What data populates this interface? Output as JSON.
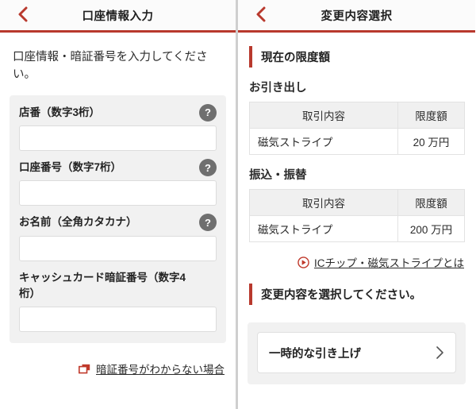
{
  "left_panel": {
    "header": {
      "title": "口座情報入力",
      "back_icon": "chevron-left-icon"
    },
    "intro_text": "口座情報・暗証番号を入力してください。",
    "fields": [
      {
        "label": "店番（数字3桁）",
        "value": "",
        "placeholder": "",
        "help_icon": "question-mark-icon",
        "help_label": "?"
      },
      {
        "label": "口座番号（数字7桁）",
        "value": "",
        "placeholder": "",
        "help_icon": "question-mark-icon",
        "help_label": "?"
      },
      {
        "label": "お名前（全角カタカナ）",
        "value": "",
        "placeholder": "",
        "help_icon": "question-mark-icon",
        "help_label": "?"
      },
      {
        "label": "キャッシュカード暗証番号（数字4桁）",
        "value": "",
        "placeholder": "",
        "help_icon": "",
        "help_label": ""
      }
    ],
    "footer_link": {
      "text": "暗証番号がわからない場合",
      "icon": "new-window-icon"
    }
  },
  "right_panel": {
    "header": {
      "title": "変更内容選択",
      "back_icon": "chevron-left-icon"
    },
    "section_current_limit": "現在の限度額",
    "groups": [
      {
        "title": "お引き出し",
        "columns": [
          "取引内容",
          "限度額"
        ],
        "rows": [
          [
            "磁気ストライプ",
            "20 万円"
          ]
        ]
      },
      {
        "title": "振込・振替",
        "columns": [
          "取引内容",
          "限度額"
        ],
        "rows": [
          [
            "磁気ストライプ",
            "200 万円"
          ]
        ]
      }
    ],
    "ic_link": {
      "text": "ICチップ・磁気ストライプとは",
      "icon": "play-circle-icon"
    },
    "section_select_change": "変更内容を選択してください。",
    "options": [
      {
        "label": "一時的な引き上げ",
        "icon": "chevron-right-icon"
      }
    ]
  },
  "colors": {
    "accent_red": "#b8392d",
    "panel_gray": "#f1f1f1",
    "table_header_gray": "#f0f0f0",
    "text_dark": "#232323",
    "help_icon_gray": "#6f6f6f"
  }
}
